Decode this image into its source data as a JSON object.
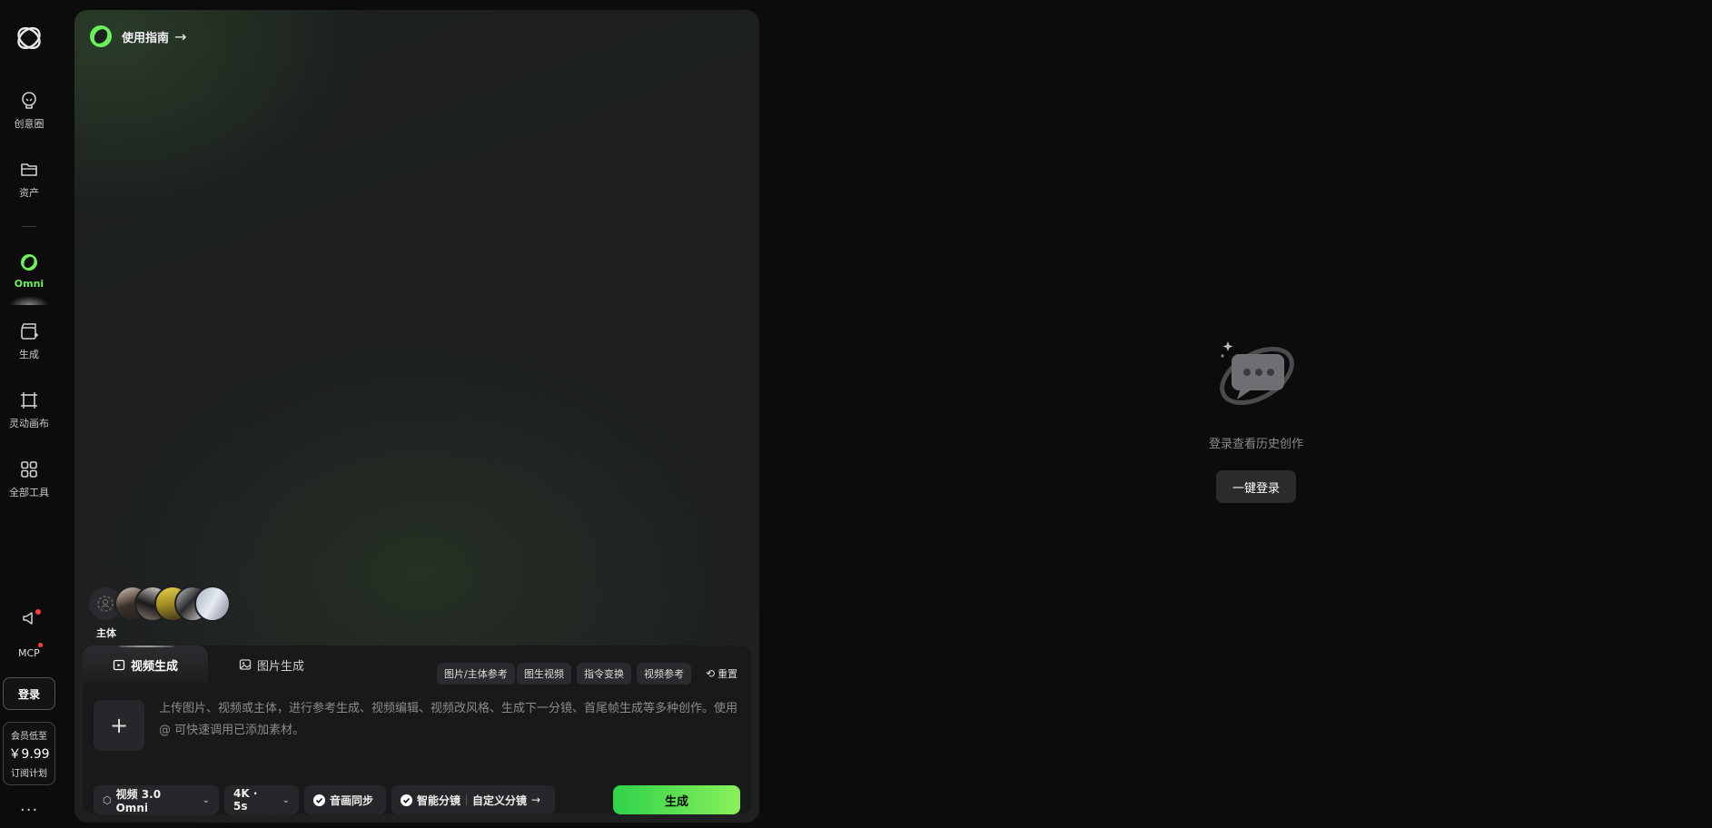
{
  "sidebar": {
    "items": [
      {
        "label": "创意圈",
        "icon": "lightbulb-icon"
      },
      {
        "label": "资产",
        "icon": "folder-icon"
      },
      {
        "label": "Omni",
        "icon": "omni-ring-icon"
      },
      {
        "label": "生成",
        "icon": "clapperboard-icon"
      },
      {
        "label": "灵动画布",
        "icon": "canvas-frame-icon"
      },
      {
        "label": "全部工具",
        "icon": "grid-icon"
      }
    ],
    "mcp_label": "MCP",
    "login_label": "登录",
    "vip": {
      "line1": "会员低至",
      "price": "￥9.99",
      "line3": "订阅计划"
    },
    "more": "···"
  },
  "panel": {
    "guide_label": "使用指南",
    "subjects_label": "主体",
    "tabs": [
      {
        "label": "视频生成",
        "active": true
      },
      {
        "label": "图片生成",
        "active": false
      }
    ],
    "chips": [
      "图片/主体参考",
      "图生视频",
      "指令变换",
      "视频参考"
    ],
    "reset_label": "重置",
    "prompt_placeholder": "上传图片、视频或主体，进行参考生成、视频编辑、视频改风格、生成下一分镜、首尾帧生成等多种创作。使用 @ 可快速调用已添加素材。",
    "model_label": "视频 3.0 Omni",
    "quality_label": "4K · 5s",
    "audio_sync_label": "音画同步",
    "smart_shot_label": "智能分镜",
    "custom_shot_label": "自定义分镜",
    "generate_label": "生成"
  },
  "right": {
    "empty_text": "登录查看历史创作",
    "login_button": "一键登录"
  },
  "colors": {
    "accent_green": "#6cf05a",
    "generate_gradient_start": "#2ed34a",
    "generate_gradient_end": "#8af05a",
    "notification_dot": "#ff3b3b"
  }
}
